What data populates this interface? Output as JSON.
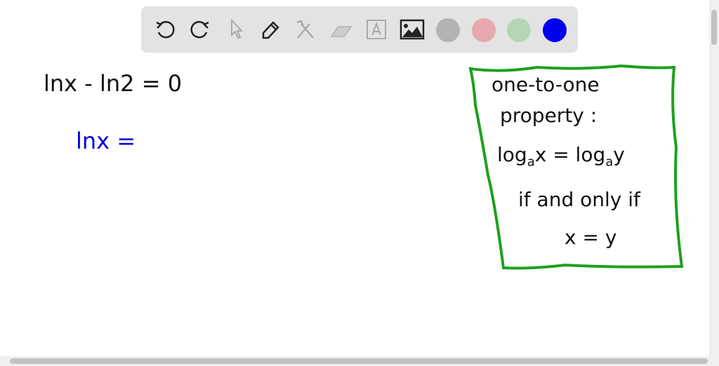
{
  "toolbar": {
    "tools": [
      "undo-icon",
      "redo-icon",
      "select-icon",
      "pen-icon",
      "tools-icon",
      "eraser-icon",
      "text-icon",
      "image-icon"
    ],
    "colors": [
      "#b3b3b3",
      "#e6a8ad",
      "#b5d6b3",
      "#0000ee"
    ]
  },
  "canvas": {
    "line1": "lnx - ln2 = 0",
    "line2": "lnx =",
    "note": {
      "border_color": "#1ea01e",
      "line1": "one-to-one",
      "line2": "property :",
      "line3_a": "log",
      "line3_sub1": "a",
      "line3_b": "x = log",
      "line3_sub2": "a",
      "line3_c": "y",
      "line4": "if and only if",
      "line5": "x = y"
    }
  }
}
